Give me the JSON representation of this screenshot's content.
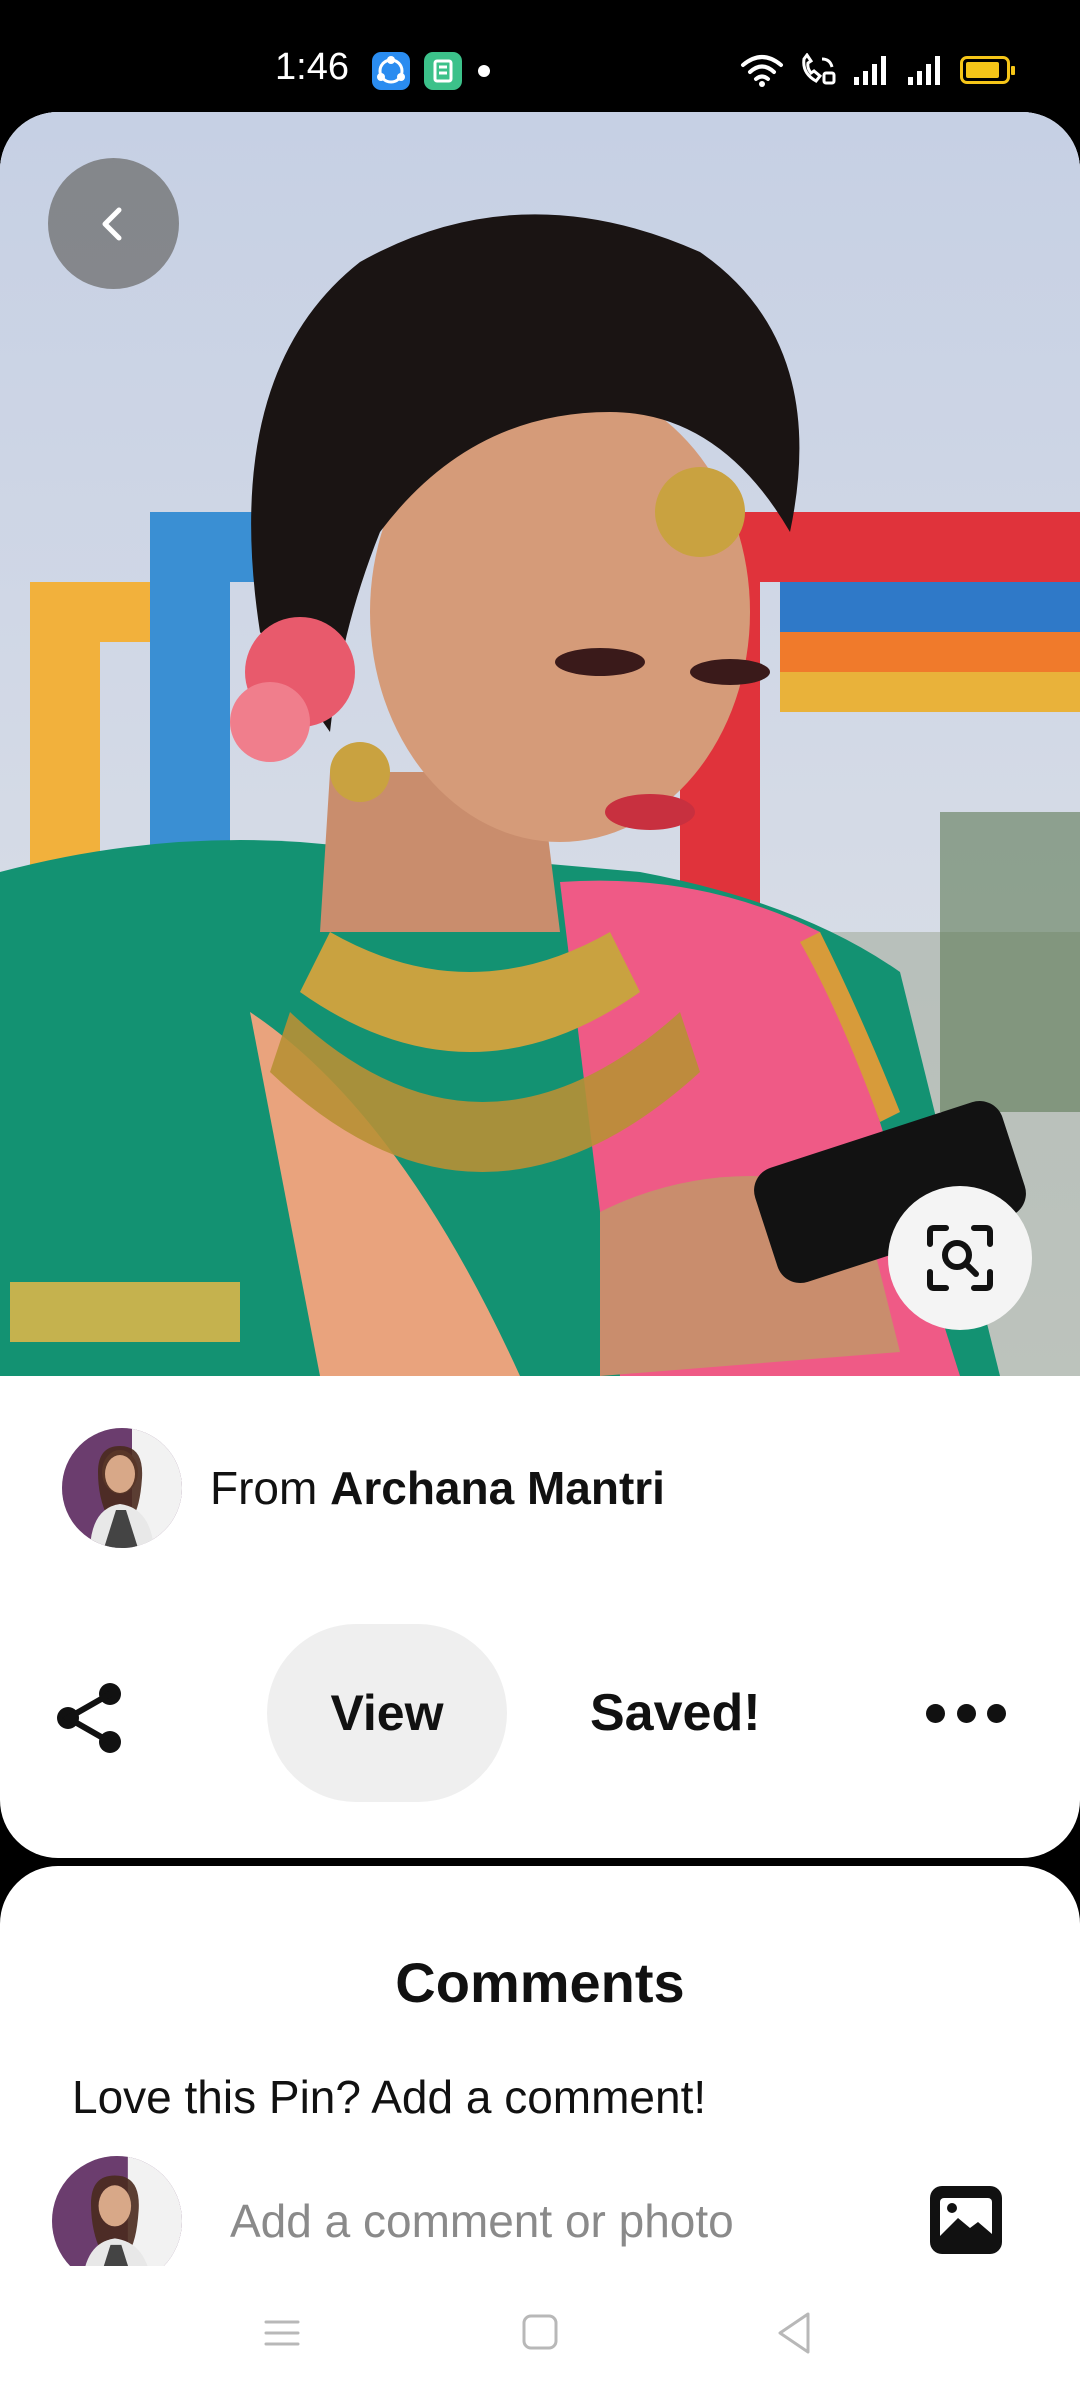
{
  "status_bar": {
    "time": "1:46",
    "app_icons": [
      "chat-app-icon",
      "store-app-icon"
    ],
    "indicators": [
      "wifi-icon",
      "wifi-calling-icon",
      "signal-icon",
      "signal-icon",
      "battery-icon"
    ],
    "battery_color": "#f5c518"
  },
  "pin": {
    "image": "portrait-photo",
    "back_icon": "chevron-left-icon",
    "lens_icon": "visual-search-icon"
  },
  "creator": {
    "prefix": "From",
    "name": "Archana Mantri"
  },
  "actions": {
    "share_icon": "share-icon",
    "view_label": "View",
    "saved_label": "Saved!",
    "more_icon": "more-dots-icon"
  },
  "comments": {
    "title": "Comments",
    "prompt": "Love this Pin? Add a comment!",
    "input_placeholder": "Add a comment or photo",
    "photo_icon": "add-photo-icon"
  },
  "nav_bar": {
    "buttons": [
      "menu-icon",
      "home-square-icon",
      "back-triangle-icon"
    ]
  }
}
